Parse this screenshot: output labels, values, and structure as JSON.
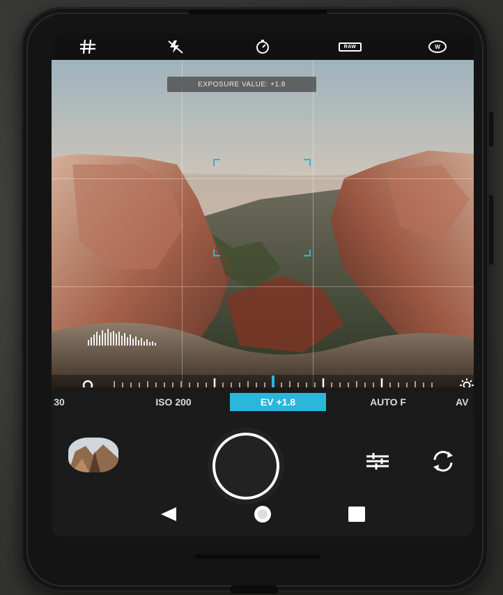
{
  "colors": {
    "accent": "#2bb6da",
    "screen_bg": "#1b1b1b",
    "phone_body": "#141414"
  },
  "topbar": {
    "icons": [
      "grid-icon",
      "flash-off-icon",
      "timer-icon",
      "raw-format-icon",
      "white-balance-icon"
    ],
    "raw_label": "RAW",
    "wb_label": "W"
  },
  "viewfinder": {
    "exposure_label": "EXPOSURE VALUE: +1.8"
  },
  "dial": {
    "left_icon": "aperture-icon",
    "right_icon": "brightness-icon"
  },
  "modes": {
    "items": [
      "30",
      "ISO 200",
      "EV +1.8",
      "AUTO F",
      "AV"
    ],
    "selected": "EV +1.8"
  },
  "controls": {
    "icons": [
      "gallery-thumbnail",
      "shutter-button",
      "adjustments-icon",
      "switch-camera-icon"
    ]
  },
  "navbar": {
    "icons": [
      "back-icon",
      "home-icon",
      "recents-icon"
    ]
  }
}
